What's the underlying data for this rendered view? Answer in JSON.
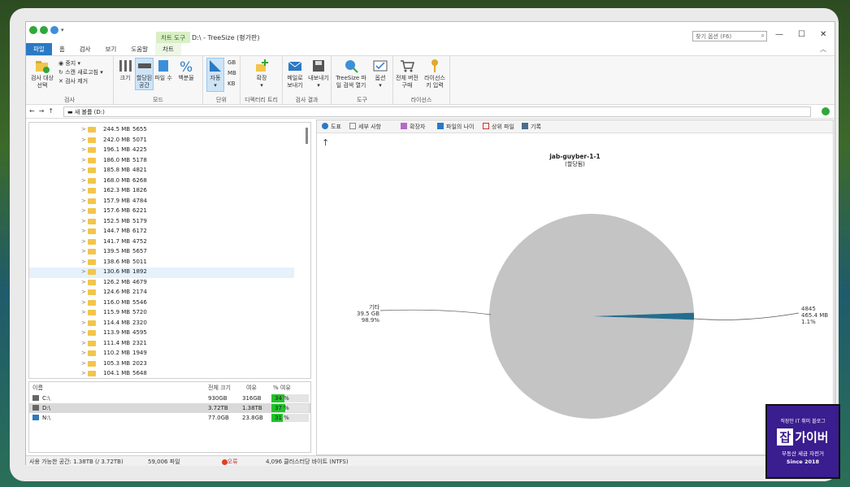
{
  "window": {
    "title": "D:\\ - TreeSize  (평가판)",
    "context_tab": "차트 도구",
    "search_placeholder": "찾기 옵션 (F6)"
  },
  "tabs": [
    "파일",
    "홈",
    "검사",
    "보기",
    "도움말",
    "차트"
  ],
  "ribbon": {
    "scan": {
      "target": "검사 대상 선택",
      "stop": "중지",
      "refresh": "스캔 새로고침",
      "remove": "검사 제거",
      "group": "검사"
    },
    "mode": {
      "size": "크기",
      "allocated": "할당된 공간",
      "files": "파일 수",
      "percent": "백분율",
      "group": "모드"
    },
    "unit": {
      "auto": "자동",
      "gb": "GB",
      "mb": "MB",
      "kb": "KB",
      "group": "단위"
    },
    "tree": {
      "expand": "확장",
      "group": "디렉터리 트리"
    },
    "results": {
      "email": "메일로 보내기",
      "export": "내보내기",
      "group": "검사 결과"
    },
    "tools": {
      "treesize_file": "TreeSize 파일 검색 열기",
      "options": "옵션",
      "group": "도구"
    },
    "license": {
      "buy": "전체 버전 구매",
      "key": "라이선스 키 입력",
      "group": "라이선스"
    }
  },
  "address": {
    "path": "새 볼륨 (D:)"
  },
  "tree_rows": [
    {
      "size": "244.5 MB",
      "count": "5655"
    },
    {
      "size": "242.0 MB",
      "count": "5071"
    },
    {
      "size": "196.1 MB",
      "count": "4225"
    },
    {
      "size": "186.0 MB",
      "count": "5178"
    },
    {
      "size": "185.8 MB",
      "count": "4821"
    },
    {
      "size": "168.0 MB",
      "count": "6268"
    },
    {
      "size": "162.3 MB",
      "count": "1826"
    },
    {
      "size": "157.9 MB",
      "count": "4784"
    },
    {
      "size": "157.6 MB",
      "count": "6221"
    },
    {
      "size": "152.5 MB",
      "count": "5179"
    },
    {
      "size": "144.7 MB",
      "count": "6172"
    },
    {
      "size": "141.7 MB",
      "count": "4752"
    },
    {
      "size": "139.5 MB",
      "count": "5657"
    },
    {
      "size": "138.6 MB",
      "count": "5011"
    },
    {
      "size": "130.6 MB",
      "count": "1892"
    },
    {
      "size": "126.2 MB",
      "count": "4679"
    },
    {
      "size": "124.6 MB",
      "count": "2174"
    },
    {
      "size": "116.0 MB",
      "count": "5546"
    },
    {
      "size": "115.9 MB",
      "count": "5720"
    },
    {
      "size": "114.4 MB",
      "count": "2320"
    },
    {
      "size": "113.9 MB",
      "count": "4595"
    },
    {
      "size": "111.4 MB",
      "count": "2321"
    },
    {
      "size": "110.2 MB",
      "count": "1949"
    },
    {
      "size": "105.3 MB",
      "count": "2023"
    },
    {
      "size": "104.1 MB",
      "count": "5648"
    }
  ],
  "drives": {
    "headers": {
      "name": "이름",
      "total": "전체 크기",
      "free": "여유",
      "pct": "% 여유"
    },
    "rows": [
      {
        "name": "C:\\",
        "total": "930GB",
        "free": "316GB",
        "pct": "34 %",
        "fraction": 0.34
      },
      {
        "name": "D:\\",
        "total": "3.72TB",
        "free": "1.38TB",
        "pct": "37 %",
        "fraction": 0.37
      },
      {
        "name": "N:\\",
        "total": "77.0GB",
        "free": "23.8GB",
        "pct": "31 %",
        "fraction": 0.31
      }
    ]
  },
  "chart_tabs": [
    "도표",
    "세부 사항",
    "확장자",
    "파일의 나이",
    "상위 파일",
    "기록"
  ],
  "chart_data": {
    "type": "pie",
    "title": "jab-guyber-1-1",
    "subtitle": "(할당됨)",
    "slices": [
      {
        "label": "기타",
        "size": "39.5 GB",
        "percent": "98.9%",
        "value": 98.9,
        "color": "#c4c4c4"
      },
      {
        "label": "4845",
        "size": "465.4 MB",
        "percent": "1.1%",
        "value": 1.1,
        "color": "#246d8f"
      }
    ]
  },
  "status": {
    "free_space": "사용 가능한 공간: 1.38TB  (/ 3.72TB)",
    "files": "59,006 파일",
    "errors": "4 오류",
    "cluster": "4,096 클러스터당 바이트 (NTFS)"
  },
  "badge": {
    "line1": "직장인 IT 취미 블로그",
    "brand_k": "잡",
    "brand_rest": "가이버",
    "line3": "부동산 세금 자전거",
    "line4": "Since 2018"
  }
}
